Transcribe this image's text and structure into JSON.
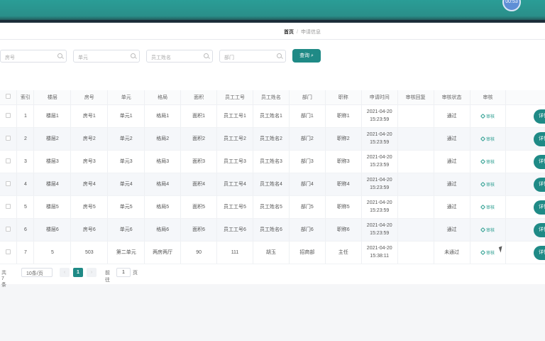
{
  "header": {
    "avatar_text": "00:53"
  },
  "breadcrumb": {
    "home": "首页",
    "sep": "/",
    "current": "申请信息"
  },
  "search": {
    "fields": [
      {
        "placeholder": "房号"
      },
      {
        "placeholder": "单元"
      },
      {
        "placeholder": "员工姓名"
      },
      {
        "placeholder": "部门"
      }
    ],
    "query_label": "查询"
  },
  "table": {
    "columns": [
      "索引",
      "楼层",
      "房号",
      "单元",
      "格局",
      "面积",
      "员工工号",
      "员工姓名",
      "部门",
      "职称",
      "申请时间",
      "审核回复",
      "审核状态",
      "审核"
    ],
    "audit_label": "审核",
    "detail_label": "详情",
    "rows": [
      {
        "idx": "1",
        "floor": "楼层1",
        "room": "房号1",
        "unit": "单元1",
        "layout": "格局1",
        "area": "面积1",
        "empno": "员工工号1",
        "name": "员工姓名1",
        "dept": "部门1",
        "title": "职称1",
        "date": "2021-04-20",
        "time": "15:23:59",
        "reply": "",
        "status": "通过"
      },
      {
        "idx": "2",
        "floor": "楼层2",
        "room": "房号2",
        "unit": "单元2",
        "layout": "格局2",
        "area": "面积2",
        "empno": "员工工号2",
        "name": "员工姓名2",
        "dept": "部门2",
        "title": "职称2",
        "date": "2021-04-20",
        "time": "15:23:59",
        "reply": "",
        "status": "通过"
      },
      {
        "idx": "3",
        "floor": "楼层3",
        "room": "房号3",
        "unit": "单元3",
        "layout": "格局3",
        "area": "面积3",
        "empno": "员工工号3",
        "name": "员工姓名3",
        "dept": "部门3",
        "title": "职称3",
        "date": "2021-04-20",
        "time": "15:23:59",
        "reply": "",
        "status": "通过"
      },
      {
        "idx": "4",
        "floor": "楼层4",
        "room": "房号4",
        "unit": "单元4",
        "layout": "格局4",
        "area": "面积4",
        "empno": "员工工号4",
        "name": "员工姓名4",
        "dept": "部门4",
        "title": "职称4",
        "date": "2021-04-20",
        "time": "15:23:59",
        "reply": "",
        "status": "通过"
      },
      {
        "idx": "5",
        "floor": "楼层5",
        "room": "房号5",
        "unit": "单元5",
        "layout": "格局5",
        "area": "面积5",
        "empno": "员工工号5",
        "name": "员工姓名5",
        "dept": "部门5",
        "title": "职称5",
        "date": "2021-04-20",
        "time": "15:23:59",
        "reply": "",
        "status": "通过"
      },
      {
        "idx": "6",
        "floor": "楼层6",
        "room": "房号6",
        "unit": "单元6",
        "layout": "格局6",
        "area": "面积6",
        "empno": "员工工号6",
        "name": "员工姓名6",
        "dept": "部门6",
        "title": "职称6",
        "date": "2021-04-20",
        "time": "15:23:59",
        "reply": "",
        "status": "通过"
      },
      {
        "idx": "7",
        "floor": "5",
        "room": "503",
        "unit": "第二单元",
        "layout": "两房两厅",
        "area": "90",
        "empno": "111",
        "name": "胡玉",
        "dept": "招商部",
        "title": "主任",
        "date": "2021-04-20",
        "time": "15:38:11",
        "reply": "",
        "status": "未通过"
      }
    ]
  },
  "pagination": {
    "total": "共 7 条",
    "page_size": "10条/页",
    "prev": "‹",
    "current": "1",
    "next": "›",
    "goto_label": "前往",
    "goto_value": "1",
    "goto_unit": "页"
  }
}
